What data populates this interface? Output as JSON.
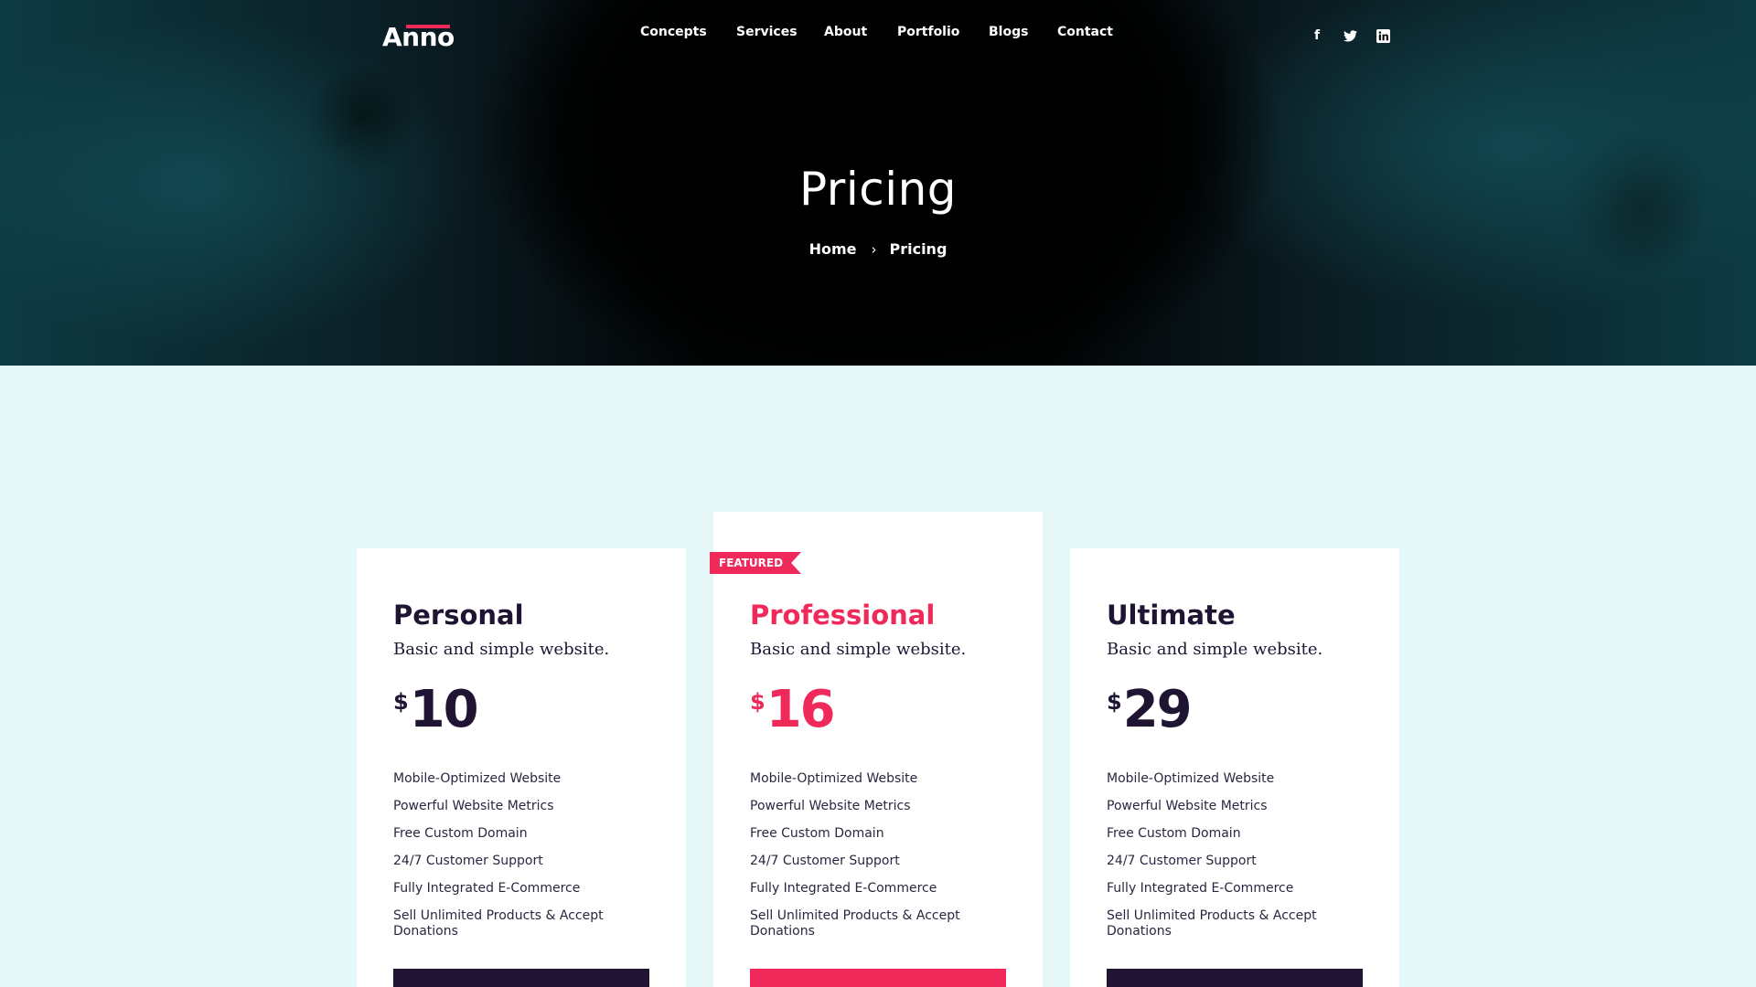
{
  "brand": {
    "logo_text": "Anno",
    "accent_color": "#f0295b",
    "dark_color": "#1f1533",
    "section_bg": "#e6f7f7"
  },
  "nav": {
    "items": [
      {
        "label": "Concepts"
      },
      {
        "label": "Services"
      },
      {
        "label": "About"
      },
      {
        "label": "Portfolio"
      },
      {
        "label": "Blogs"
      },
      {
        "label": "Contact"
      }
    ]
  },
  "social": [
    {
      "icon": "facebook-icon",
      "glyph": "f"
    },
    {
      "icon": "twitter-icon",
      "glyph": "🐦"
    },
    {
      "icon": "linkedin-icon",
      "glyph": "in"
    }
  ],
  "hero": {
    "title": "Pricing",
    "breadcrumb": {
      "home": "Home",
      "separator": "›",
      "current": "Pricing"
    }
  },
  "plans": [
    {
      "name": "Personal",
      "subtitle": "Basic and simple website.",
      "currency": "$",
      "price": "10",
      "featured": false,
      "features": [
        "Mobile-Optimized Website",
        "Powerful Website Metrics",
        "Free Custom Domain",
        "24/7 Customer Support",
        "Fully Integrated E-Commerce",
        "Sell Unlimited Products & Accept Donations"
      ]
    },
    {
      "name": "Professional",
      "subtitle": "Basic and simple website.",
      "currency": "$",
      "price": "16",
      "featured": true,
      "badge": "FEATURED",
      "features": [
        "Mobile-Optimized Website",
        "Powerful Website Metrics",
        "Free Custom Domain",
        "24/7 Customer Support",
        "Fully Integrated E-Commerce",
        "Sell Unlimited Products & Accept Donations"
      ]
    },
    {
      "name": "Ultimate",
      "subtitle": "Basic and simple website.",
      "currency": "$",
      "price": "29",
      "featured": false,
      "features": [
        "Mobile-Optimized Website",
        "Powerful Website Metrics",
        "Free Custom Domain",
        "24/7 Customer Support",
        "Fully Integrated E-Commerce",
        "Sell Unlimited Products & Accept Donations"
      ]
    }
  ]
}
